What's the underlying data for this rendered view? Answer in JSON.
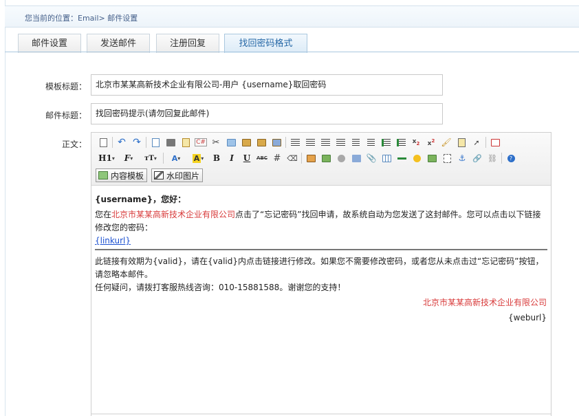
{
  "breadcrumb": "您当前的位置：Email> 邮件设置",
  "tabs": [
    {
      "label": "邮件设置",
      "active": false
    },
    {
      "label": "发送邮件",
      "active": false
    },
    {
      "label": "注册回复",
      "active": false
    },
    {
      "label": "找回密码格式",
      "active": true
    }
  ],
  "form": {
    "template_title_label": "模板标题：",
    "template_title_value": "北京市某某高新技术企业有限公司-用户 {username}取回密码",
    "mail_subject_label": "邮件标题：",
    "mail_subject_value": "找回密码提示(请勿回复此邮件)",
    "body_label": "正文："
  },
  "toolbar": {
    "heading": "H1",
    "font": "F",
    "fontsize": "тT",
    "bold": "B",
    "italic": "I",
    "underline": "U",
    "strike": "ABC",
    "template_button": "内容模板",
    "watermark_button": "水印图片"
  },
  "colors": {
    "tab_active": "#2467a6",
    "highlight_text": "#d83b3b",
    "link": "#1a4fd0",
    "highlight_bg": "#f4d320"
  },
  "content": {
    "greeting": "{username}，您好：",
    "para1_a": "您在",
    "para1_company": "北京市某某高新技术企业有限公司",
    "para1_b": "点击了“忘记密码”找回申请，故系统自动为您发送了这封邮件。您可以点击以下链接修改您的密码：",
    "link": "{linkurl}",
    "para2": "此链接有效期为{valid}，请在{valid}内点击链接进行修改。如果您不需要修改密码，或者您从未点击过“忘记密码”按钮，请忽略本邮件。",
    "para3": "任何疑问，请拨打客服热线咨询：010-15881588。谢谢您的支持！",
    "signature_company": "北京市某某高新技术企业有限公司",
    "signature_url": "{weburl}"
  }
}
